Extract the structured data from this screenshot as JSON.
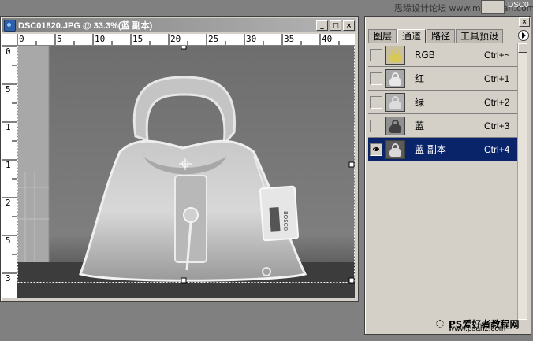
{
  "top": {
    "watermark": "思缘设计论坛  www.missyuan.com",
    "doc_label": "DSC0"
  },
  "document": {
    "title": "DSC01820.JPG @ 33.3%(蓝 副本)",
    "minimize": "_",
    "maximize": "□",
    "close": "×",
    "ruler_top": [
      "0",
      "5",
      "10",
      "15",
      "20",
      "25",
      "30",
      "35",
      "40"
    ],
    "ruler_left": [
      "0",
      "5",
      "1",
      "1",
      "2",
      "5",
      "3"
    ],
    "tag_text": "BOSCO"
  },
  "panel": {
    "tabs": [
      "图层",
      "通道",
      "路径",
      "工具预设"
    ],
    "active_tab": "通道",
    "close": "×",
    "channels": [
      {
        "name": "RGB",
        "shortcut": "Ctrl+~",
        "visible": false,
        "selected": false,
        "thumb": "#c8c0a0",
        "bag": "#d8c858"
      },
      {
        "name": "红",
        "shortcut": "Ctrl+1",
        "visible": false,
        "selected": false,
        "thumb": "#a8a8a8",
        "bag": "#e8e8e8"
      },
      {
        "name": "绿",
        "shortcut": "Ctrl+2",
        "visible": false,
        "selected": false,
        "thumb": "#b0b0b0",
        "bag": "#dcdcdc"
      },
      {
        "name": "蓝",
        "shortcut": "Ctrl+3",
        "visible": false,
        "selected": false,
        "thumb": "#909090",
        "bag": "#404040"
      },
      {
        "name": "蓝 副本",
        "shortcut": "Ctrl+4",
        "visible": true,
        "selected": true,
        "thumb": "#5a5a5a",
        "bag": "#d8d8d8"
      }
    ],
    "footer_text": "PS爱好者教程网",
    "footer_url": "www.psahz.com"
  },
  "colors": {
    "selection": "#0a246a",
    "window_face": "#d4d0c8",
    "desktop": "#808080"
  }
}
